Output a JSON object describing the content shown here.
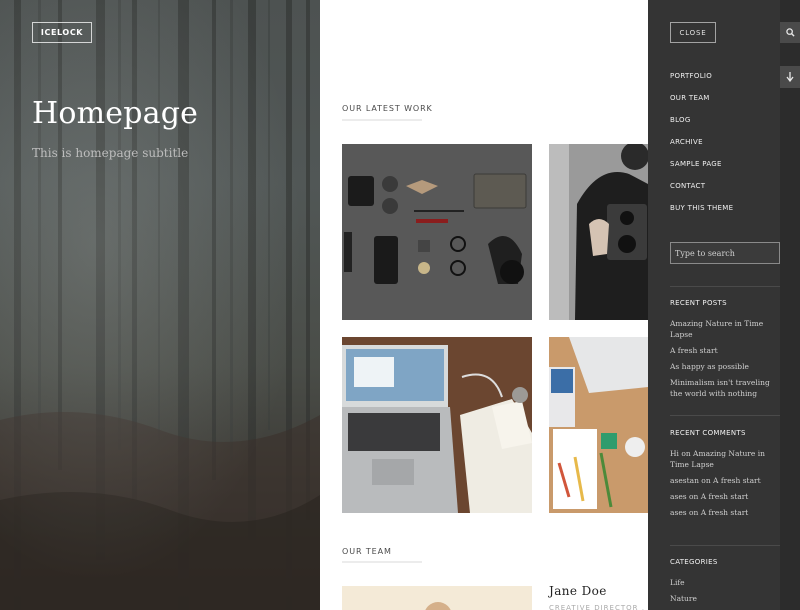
{
  "hero": {
    "logo": "ICELOCK",
    "title": "Homepage",
    "subtitle": "This is homepage subtitle"
  },
  "main": {
    "latest_work_label": "OUR LATEST WORK",
    "team_label": "OUR TEAM",
    "portfolio_items": [
      "flat-lay-accessories",
      "camera-portrait",
      "laptop-desk",
      "desk-top-view"
    ],
    "team": [
      {
        "name": "Jane Doe",
        "role": "CREATIVE DIRECTOR , DES"
      }
    ]
  },
  "panel": {
    "close_label": "CLOSE",
    "nav": [
      "PORTFOLIO",
      "OUR TEAM",
      "BLOG",
      "ARCHIVE",
      "SAMPLE PAGE",
      "CONTACT",
      "BUY THIS THEME"
    ],
    "search": {
      "placeholder": "Type to search"
    },
    "recent_posts": {
      "title": "RECENT POSTS",
      "items": [
        "Amazing Nature in Time Lapse",
        "A fresh start",
        "As happy as possible",
        "Minimalism isn't traveling the world with nothing"
      ]
    },
    "recent_comments": {
      "title": "RECENT COMMENTS",
      "items": [
        "Hi on Amazing Nature in Time Lapse",
        "asestan on A fresh start",
        "ases on A fresh start",
        "ases on A fresh start"
      ]
    },
    "categories": {
      "title": "CATEGORIES",
      "items": [
        "Life",
        "Nature"
      ]
    }
  },
  "strip": {
    "search_icon": "search-icon",
    "scroll_icon": "arrow-down-icon"
  },
  "colors": {
    "panel_bg": "#343434",
    "strip_bg": "#2c2c2c",
    "text_light": "#f0f0f0"
  }
}
